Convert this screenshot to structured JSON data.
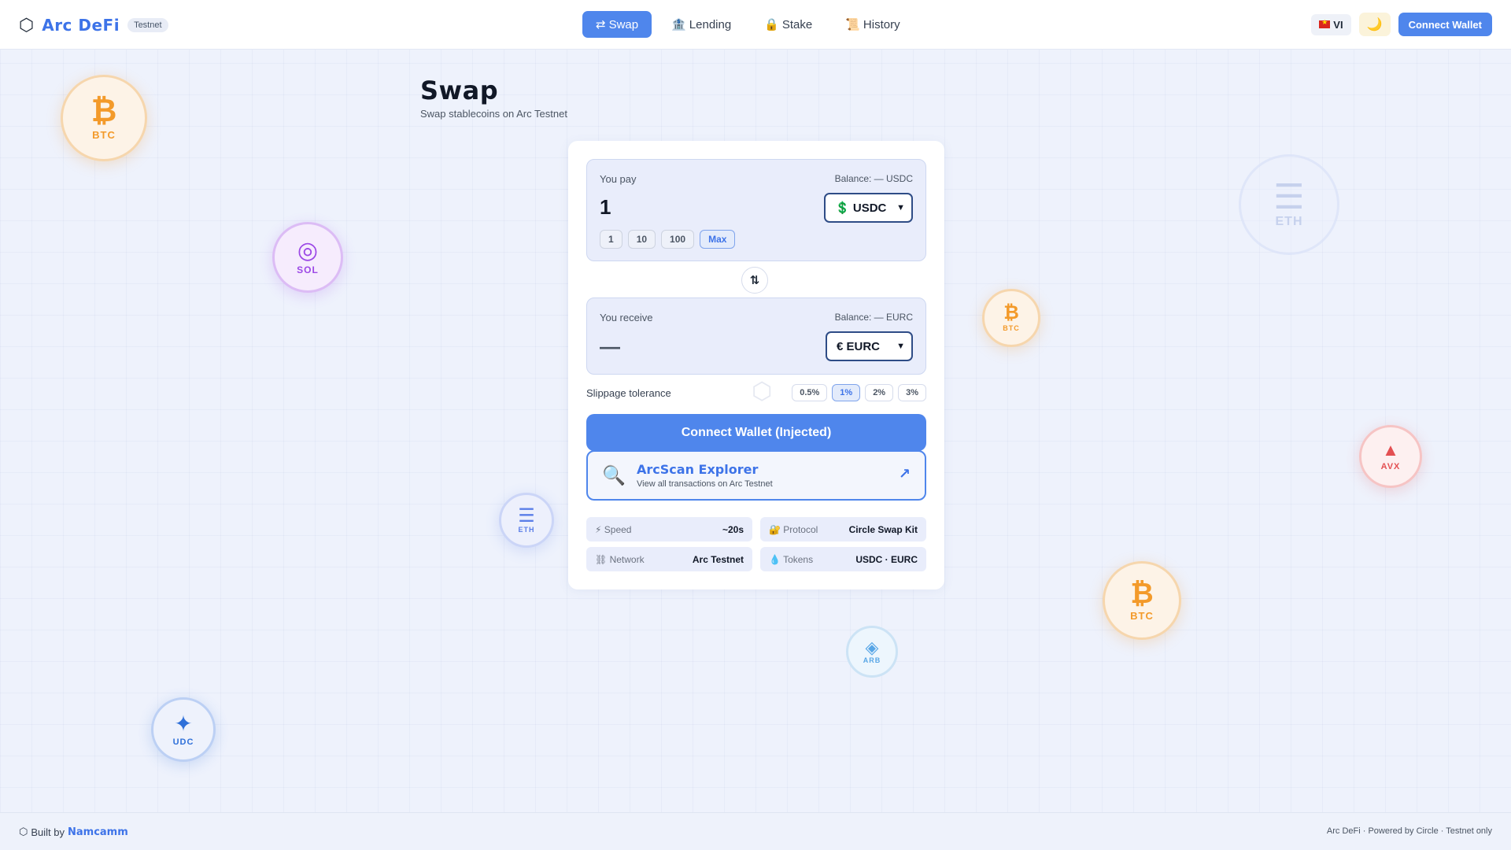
{
  "header": {
    "brand_icon": "⬡",
    "brand_name": "Arc DeFi",
    "badge": "Testnet",
    "nav": [
      {
        "icon": "⇄",
        "label": "Swap",
        "active": true
      },
      {
        "icon": "🏦",
        "label": "Lending",
        "active": false
      },
      {
        "icon": "🔒",
        "label": "Stake",
        "active": false
      },
      {
        "icon": "📜",
        "label": "History",
        "active": false
      }
    ],
    "language": "VI",
    "theme_icon": "🌙",
    "connect_label": "Connect Wallet"
  },
  "coins": [
    {
      "symbol": "₿",
      "label": "BTC"
    },
    {
      "symbol": "◎",
      "label": "SOL"
    },
    {
      "symbol": "☰",
      "label": "ETH"
    },
    {
      "symbol": "₿",
      "label": "BTC"
    },
    {
      "symbol": "▲",
      "label": "AVX"
    },
    {
      "symbol": "☰",
      "label": "ETH"
    },
    {
      "symbol": "₿",
      "label": "BTC"
    },
    {
      "symbol": "◈",
      "label": "ARB"
    },
    {
      "symbol": "✦",
      "label": "UDC"
    }
  ],
  "page": {
    "title": "Swap",
    "subtitle": "Swap stablecoins on Arc Testnet"
  },
  "pay": {
    "label": "You pay",
    "balance": "Balance: — USDC",
    "amount": "1",
    "token_icon": "💲",
    "token": "USDC",
    "presets": [
      "1",
      "10",
      "100",
      "Max"
    ]
  },
  "swap_icon": "⇅",
  "receive": {
    "label": "You receive",
    "balance": "Balance: — EURC",
    "amount": "—",
    "token_icon": "€",
    "token": "EURC"
  },
  "slippage": {
    "label": "Slippage tolerance",
    "options": [
      "0.5%",
      "1%",
      "2%",
      "3%"
    ],
    "selected": "1%"
  },
  "connect_main_label": "Connect Wallet (Injected)",
  "explorer": {
    "icon": "🔍",
    "title": "ArcScan Explorer",
    "subtitle": "View all transactions on Arc Testnet",
    "arrow": "↗"
  },
  "info": [
    {
      "icon": "⚡",
      "key": "Speed",
      "value": "~20s"
    },
    {
      "icon": "🔐",
      "key": "Protocol",
      "value": "Circle Swap Kit"
    },
    {
      "icon": "⛓",
      "key": "Network",
      "value": "Arc Testnet"
    },
    {
      "icon": "💧",
      "key": "Tokens",
      "value": "USDC · EURC"
    }
  ],
  "footer": {
    "icon": "⬡",
    "built_by": "Built by",
    "author": "Namcamm",
    "right": "Arc DeFi · Powered by Circle · Testnet only"
  },
  "colors": {
    "accent": "#4f86ec",
    "brand_text": "#3d73e8",
    "background": "#eef2fc"
  }
}
